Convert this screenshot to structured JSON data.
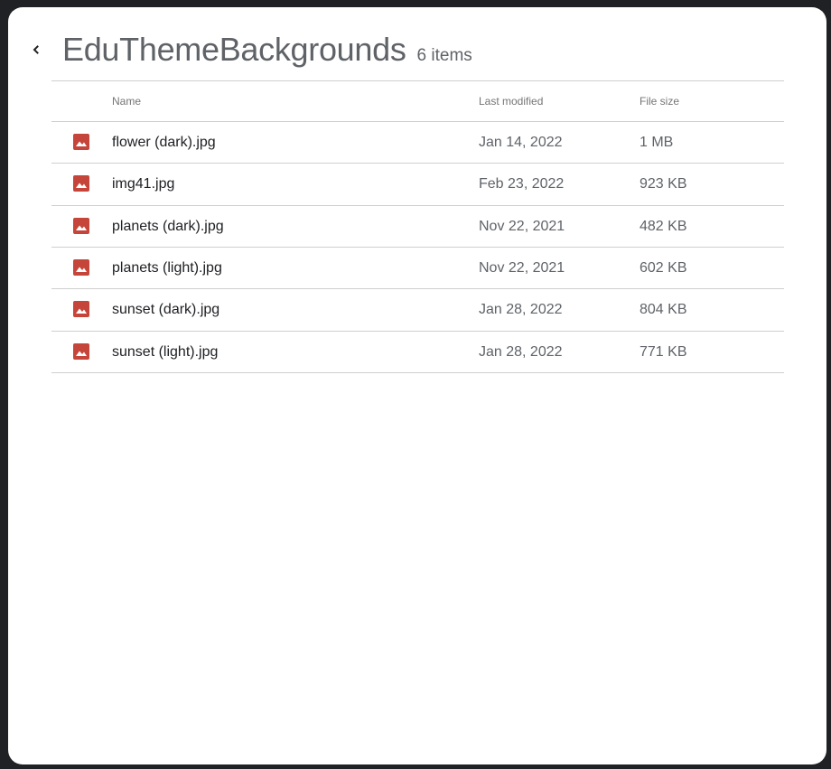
{
  "header": {
    "title": "EduThemeBackgrounds",
    "item_count": "6 items",
    "back_icon": "chevron-left-icon"
  },
  "table": {
    "columns": {
      "name": "Name",
      "last_modified": "Last modified",
      "file_size": "File size"
    },
    "file_icon": "image-file-icon",
    "icon_color": "#c5453a",
    "rows": [
      {
        "name": "flower (dark).jpg",
        "modified": "Jan 14, 2022",
        "size": "1 MB"
      },
      {
        "name": "img41.jpg",
        "modified": "Feb 23, 2022",
        "size": "923 KB"
      },
      {
        "name": "planets (dark).jpg",
        "modified": "Nov 22, 2021",
        "size": "482 KB"
      },
      {
        "name": "planets (light).jpg",
        "modified": "Nov 22, 2021",
        "size": "602 KB"
      },
      {
        "name": "sunset (dark).jpg",
        "modified": "Jan 28, 2022",
        "size": "804 KB"
      },
      {
        "name": "sunset (light).jpg",
        "modified": "Jan 28, 2022",
        "size": "771 KB"
      }
    ]
  }
}
